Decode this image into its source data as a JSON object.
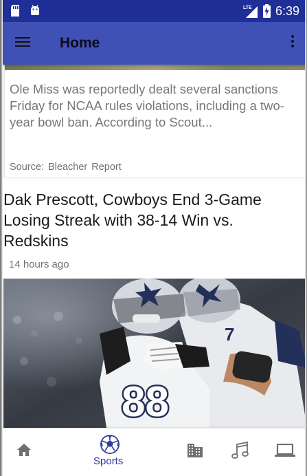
{
  "status_bar": {
    "time": "6:39",
    "network_label": "LTE",
    "left_icons": [
      "sd-card-icon",
      "android-icon"
    ],
    "right_icons": [
      "lte-signal-icon",
      "battery-charging-icon"
    ]
  },
  "app_bar": {
    "title": "Home",
    "menu_icon": "hamburger-menu-icon",
    "overflow_icon": "more-vert-icon"
  },
  "feed": [
    {
      "description": "Ole Miss was reportedly dealt several sanctions Friday for NCAA rules violations, including a two-year bowl ban.    According to Scout...",
      "source_label": "Source:",
      "source": "Bleacher Report"
    },
    {
      "title": "Dak Prescott, Cowboys End 3-Game Losing Streak with 38-14 Win vs. Redskins",
      "time_ago": "14 hours ago",
      "image_subject": "football players celebrating, jersey number 88"
    }
  ],
  "bottom_nav": {
    "items": [
      {
        "icon": "home-icon",
        "label": ""
      },
      {
        "icon": "soccer-ball-icon",
        "label": "Sports",
        "active": true
      },
      {
        "icon": "city-icon",
        "label": ""
      },
      {
        "icon": "music-note-icon",
        "label": ""
      },
      {
        "icon": "laptop-icon",
        "label": ""
      }
    ]
  },
  "colors": {
    "status_bar": "#1f2f97",
    "app_bar": "#3f51b5",
    "accent": "#2e3e9e",
    "secondary_text": "#777777",
    "icon_gray": "#707070"
  }
}
